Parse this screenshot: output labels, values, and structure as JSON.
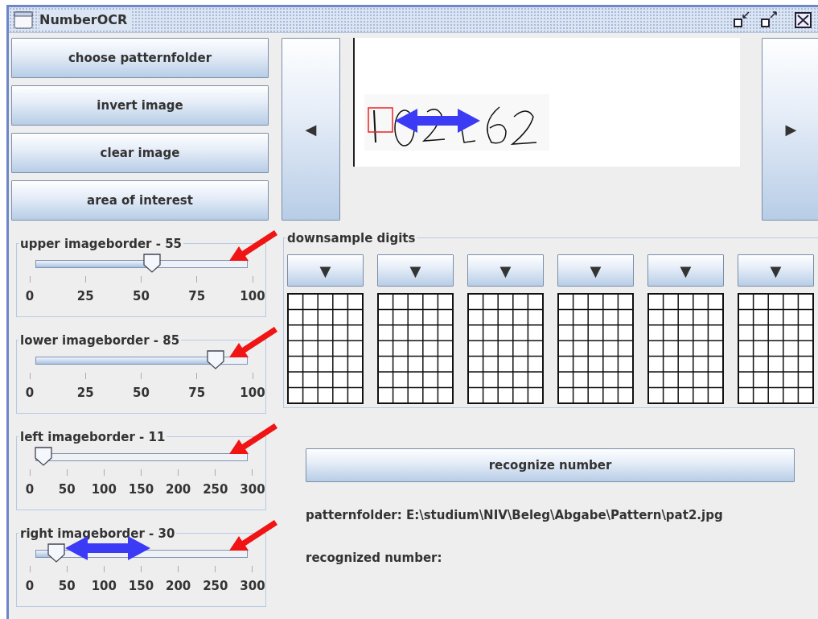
{
  "window": {
    "title": "NumberOCR"
  },
  "actions": [
    "choose patternfolder",
    "invert image",
    "clear image",
    "area of interest"
  ],
  "sliders": [
    {
      "label": "upper imageborder - 55",
      "level": 0.55,
      "ticks": [
        "0",
        "25",
        "50",
        "75",
        "100"
      ]
    },
    {
      "label": "lower imageborder - 85",
      "level": 0.85,
      "ticks": [
        "0",
        "25",
        "50",
        "75",
        "100"
      ]
    },
    {
      "label": "left imageborder - 11",
      "level": 0.037,
      "ticks": [
        "0",
        "50",
        "100",
        "150",
        "200",
        "250",
        "300"
      ]
    },
    {
      "label": "right imageborder - 30",
      "level": 0.1,
      "ticks": [
        "0",
        "50",
        "100",
        "150",
        "200",
        "250",
        "300"
      ]
    }
  ],
  "navigation": {
    "previous": "◀",
    "next": "▶"
  },
  "downsample": {
    "title": "downsample digits",
    "digits": [
      {
        "dropdown": "▼"
      },
      {
        "dropdown": "▼"
      },
      {
        "dropdown": "▼"
      },
      {
        "dropdown": "▼"
      },
      {
        "dropdown": "▼"
      },
      {
        "dropdown": "▼"
      }
    ]
  },
  "recognize_button": "recognize number",
  "patternfolder_text": "patternfolder: E:\\studium\\NIV\\Beleg\\Abgabe\\Pattern\\pat2.jpg",
  "recognized_text": "recognized number:"
}
